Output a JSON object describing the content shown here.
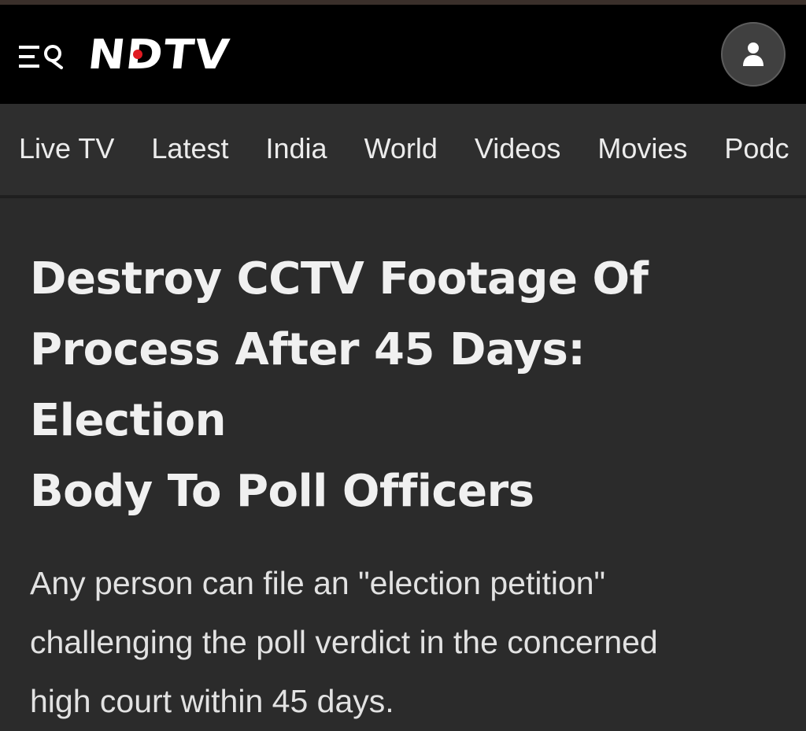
{
  "header": {
    "menu_icon": "hamburger-search-icon",
    "logo_text": "NDTV",
    "account_icon": "user-icon"
  },
  "colors": {
    "header_bg": "#000000",
    "nav_bg": "#2e2e2e",
    "page_bg": "#2b2b2b",
    "logo_dot": "#e01b22",
    "text": "#f0f0f0"
  },
  "nav": {
    "items": [
      {
        "label": "Live TV"
      },
      {
        "label": "Latest"
      },
      {
        "label": "India"
      },
      {
        "label": "World"
      },
      {
        "label": "Videos"
      },
      {
        "label": "Movies"
      },
      {
        "label": "Podc"
      }
    ]
  },
  "article": {
    "headline_lines": [
      "Destroy CCTV Footage Of",
      "Process After 45 Days: Election",
      "Body To Poll Officers"
    ],
    "summary_lines": [
      "Any person can file an \"election petition\"",
      "challenging the poll verdict in the concerned",
      "high court within 45 days."
    ]
  }
}
